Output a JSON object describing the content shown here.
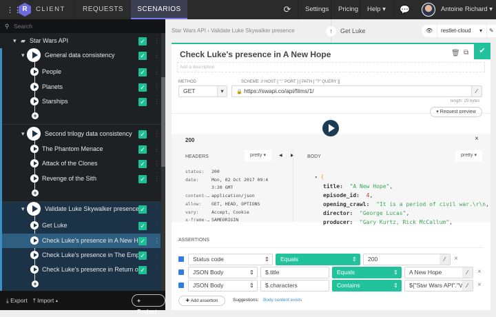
{
  "topbar": {
    "logo_letter": "R",
    "app": "CLIENT",
    "tabs": [
      "REQUESTS",
      "SCENARIOS"
    ],
    "active_tab": "SCENARIOS",
    "nav": [
      "Settings",
      "Pricing",
      "Help"
    ],
    "user": "Antoine Richard"
  },
  "sidebar": {
    "search_placeholder": "Search",
    "project": "Star Wars API",
    "scenarios": [
      {
        "name": "General data consistency",
        "requests": [
          "People",
          "Planets",
          "Starships"
        ]
      },
      {
        "name": "Second trilogy data consistency",
        "requests": [
          "The Phantom Menace",
          "Attack of the Clones",
          "Revenge of the Sith"
        ]
      },
      {
        "name": "Validate Luke Skywalker presence",
        "requests": [
          "Get Luke",
          "Check Luke's presence in A New H...",
          "Check Luke's presence in The Empi...",
          "Check Luke's presence in Return of ..."
        ]
      }
    ],
    "selected": "Check Luke's presence in A New H...",
    "footer": {
      "export": "Export",
      "import": "Import",
      "project": "Project"
    }
  },
  "main": {
    "breadcrumb": [
      "Star Wars API",
      "Validate Luke Skywalker presence"
    ],
    "previous": "Get Luke",
    "environment": "restlet-cloud",
    "title": "Check Luke's presence in A New Hope",
    "description_placeholder": "Add a description",
    "method_label": "METHOD",
    "method": "GET",
    "url_label": "SCHEME :// HOST [ \":\" PORT ] [ PATH [ \"?\" QUERY ]]",
    "url": "https://swapi.co/api/films/1/",
    "length": "length: 29 bytes",
    "request_preview": "Request preview",
    "response": {
      "status": "200",
      "headers_label": "HEADERS",
      "body_label": "BODY",
      "format": "pretty",
      "headers": [
        [
          "status:",
          "200"
        ],
        [
          "date:",
          "Mon, 02 Oct 2017 09:4"
        ],
        [
          "",
          "3:20 GMT"
        ],
        [
          "content-…",
          "application/json"
        ],
        [
          "allow:",
          "GET, HEAD, OPTIONS"
        ],
        [
          "vary:",
          "Accept, Cookie"
        ],
        [
          "x-frame-…",
          "SAMEORIGIN"
        ]
      ],
      "body": [
        [
          "title",
          "\"A New Hope\""
        ],
        [
          "episode_id",
          "4"
        ],
        [
          "opening_crawl",
          "\"It is a period of civil war.\\r\\n"
        ],
        [
          "director",
          "\"George Lucas\""
        ],
        [
          "producer",
          "\"Gary Kurtz, Rick McCallum\""
        ]
      ]
    },
    "assertions": {
      "label": "ASSERTIONS",
      "rows": [
        {
          "source": "Status code",
          "path": "",
          "comparison": "Equals",
          "value": "200"
        },
        {
          "source": "JSON Body",
          "path": "$.title",
          "comparison": "Equals",
          "value": "A New Hope"
        },
        {
          "source": "JSON Body",
          "path": "$.characters",
          "comparison": "Contains",
          "value": "${\"Star Wars API\".\"Val"
        }
      ],
      "add": "Add assertion",
      "suggestions_label": "Suggestions:",
      "suggestion": "Body content exists"
    }
  },
  "colors": {
    "accent": "#22c39c",
    "sidebar": "#1e2124",
    "selected": "#2e5f80",
    "scenario_active": "#1b3247",
    "tab_active": "#3c3e52",
    "link": "#2f8fd8"
  }
}
